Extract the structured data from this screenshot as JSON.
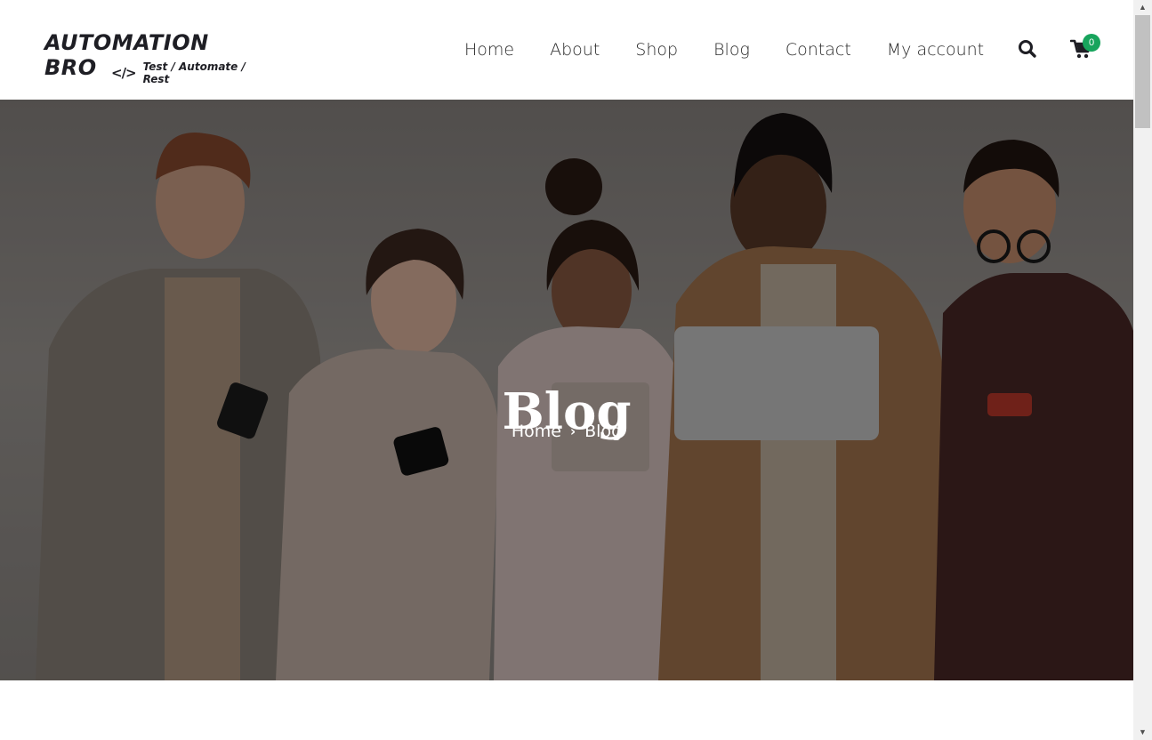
{
  "brand": {
    "title": "AUTOMATION BRO",
    "tagline": "Test / Automate / Rest"
  },
  "nav": {
    "items": [
      "Home",
      "About",
      "Shop",
      "Blog",
      "Contact",
      "My account"
    ]
  },
  "header_icons": {
    "search": "search-icon",
    "cart": "cart-icon",
    "cart_count": "0"
  },
  "hero": {
    "title": "Blog",
    "breadcrumb": [
      "Home",
      "Blog"
    ],
    "separator": "›"
  },
  "colors": {
    "accent": "#17a45c",
    "text": "#2a2a2a",
    "hero_text": "#ffffff"
  }
}
